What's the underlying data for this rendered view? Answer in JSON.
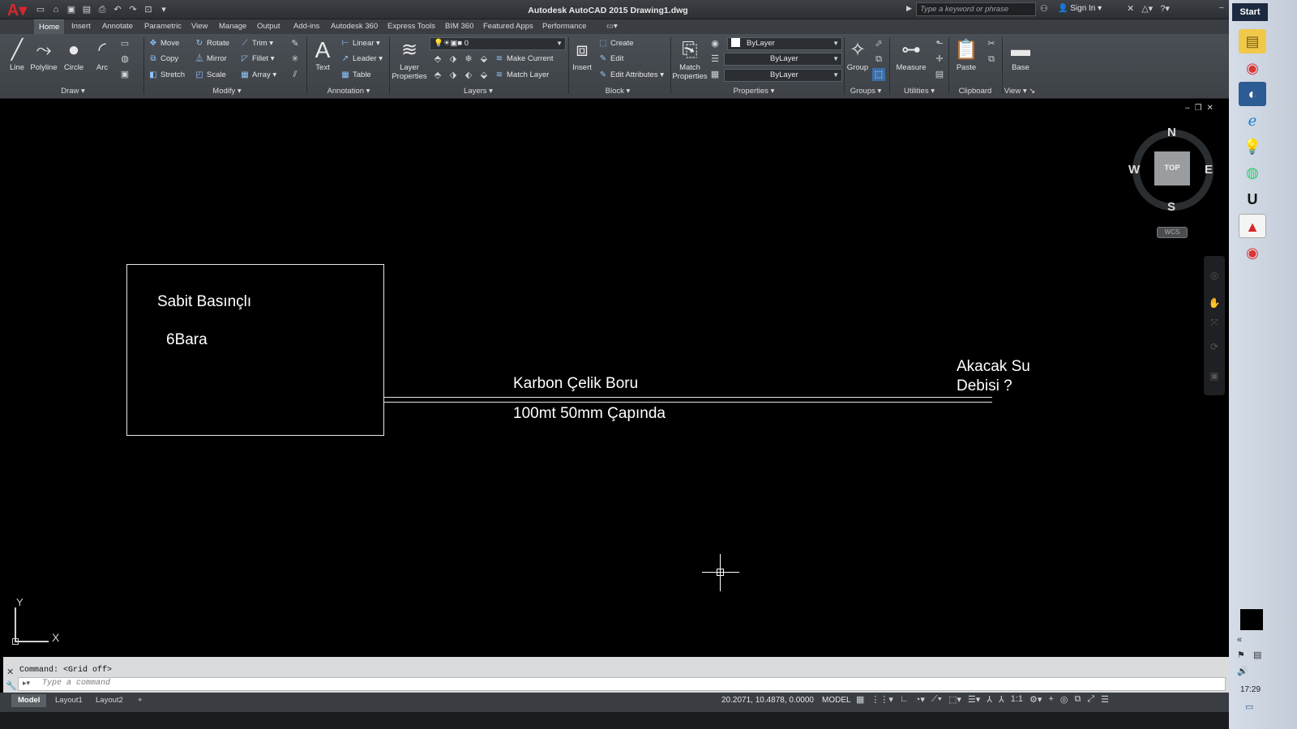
{
  "titlebar": {
    "title": "Autodesk AutoCAD 2015    Drawing1.dwg",
    "search_placeholder": "Type a keyword or phrase",
    "signin": "Sign In"
  },
  "tabs": [
    "Home",
    "Insert",
    "Annotate",
    "Parametric",
    "View",
    "Manage",
    "Output",
    "Add-ins",
    "Autodesk 360",
    "Express Tools",
    "BIM 360",
    "Featured Apps",
    "Performance"
  ],
  "ribbon": {
    "draw": {
      "line": "Line",
      "polyline": "Polyline",
      "circle": "Circle",
      "arc": "Arc",
      "panel": "Draw"
    },
    "modify": {
      "move": "Move",
      "rotate": "Rotate",
      "trim": "Trim",
      "copy": "Copy",
      "mirror": "Mirror",
      "fillet": "Fillet",
      "stretch": "Stretch",
      "scale": "Scale",
      "array": "Array",
      "panel": "Modify"
    },
    "annotation": {
      "text": "Text",
      "linear": "Linear",
      "leader": "Leader",
      "table": "Table",
      "panel": "Annotation"
    },
    "layers": {
      "layer_properties": "Layer Properties",
      "layer_value": "0",
      "make_current": "Make Current",
      "match_layer": "Match Layer",
      "panel": "Layers"
    },
    "block": {
      "insert": "Insert",
      "create": "Create",
      "edit": "Edit",
      "edit_attributes": "Edit Attributes",
      "panel": "Block"
    },
    "properties": {
      "match_properties": "Match Properties",
      "color": "ByLayer",
      "linetype": "ByLayer",
      "lineweight": "ByLayer",
      "panel": "Properties"
    },
    "groups": {
      "group": "Group",
      "panel": "Groups"
    },
    "utilities": {
      "measure": "Measure",
      "panel": "Utilities"
    },
    "clipboard": {
      "paste": "Paste",
      "panel": "Clipboard"
    },
    "view": {
      "base": "Base",
      "panel": "View"
    }
  },
  "drawing": {
    "label1": "Sabit Basınçlı",
    "label2": "6Bara",
    "label3": "Karbon Çelik Boru",
    "label4": "100mt 50mm Çapında",
    "label5_line1": "Akacak Su",
    "label5_line2": "Debisi ?"
  },
  "viewcube": {
    "north": "N",
    "south": "S",
    "east": "E",
    "west": "W",
    "face": "TOP",
    "wcs": "WCS"
  },
  "ucs": {
    "x": "X",
    "y": "Y"
  },
  "command": {
    "history": "Command:  <Grid off>",
    "placeholder": "Type a command"
  },
  "layout_tabs": [
    "Model",
    "Layout1",
    "Layout2",
    "+"
  ],
  "status": {
    "coords": "20.2071, 10.4878, 0.0000",
    "model": "MODEL",
    "scale": "1:1"
  },
  "windows": {
    "start": "Start",
    "clock": "17:29"
  }
}
